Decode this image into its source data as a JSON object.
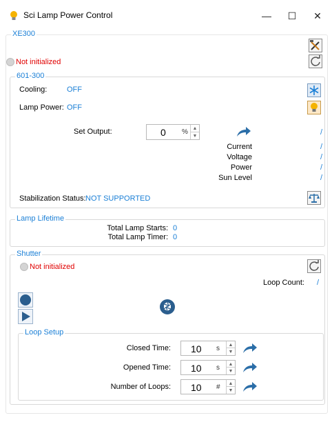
{
  "window": {
    "title": "Sci Lamp Power Control",
    "minimize_glyph": "—",
    "maximize_glyph": "☐",
    "close_glyph": "✕"
  },
  "xe300": {
    "legend": "XE300",
    "status": "Not initialized"
  },
  "psu": {
    "legend": "601-300",
    "cooling_label": "Cooling:",
    "cooling_value": "OFF",
    "lamp_power_label": "Lamp Power:",
    "lamp_power_value": "OFF",
    "set_output_label": "Set Output:",
    "set_output_value": "0",
    "set_output_unit": "%",
    "set_output_readout": "/",
    "readings": [
      {
        "label": "Current",
        "value": "/"
      },
      {
        "label": "Voltage",
        "value": "/"
      },
      {
        "label": "Power",
        "value": "/"
      },
      {
        "label": "Sun Level",
        "value": "/"
      }
    ],
    "stabilization_label": "Stabilization Status:",
    "stabilization_value": "NOT SUPPORTED"
  },
  "lifetime": {
    "legend": "Lamp Lifetime",
    "starts_label": "Total Lamp Starts:",
    "starts_value": "0",
    "timer_label": "Total Lamp Timer:",
    "timer_value": "0"
  },
  "shutter": {
    "legend": "Shutter",
    "status": "Not initialized",
    "loop_count_label": "Loop Count:",
    "loop_count_value": "/",
    "loop_setup": {
      "legend": "Loop Setup",
      "rows": [
        {
          "label": "Closed Time:",
          "value": "10",
          "unit": "s"
        },
        {
          "label": "Opened Time:",
          "value": "10",
          "unit": "s"
        },
        {
          "label": "Number of Loops:",
          "value": "10",
          "unit": "#"
        }
      ]
    }
  },
  "icons": {
    "app": "lightbulb-icon",
    "tools": "tools-icon",
    "refresh": "refresh-icon",
    "cooling": "snowflake-icon",
    "lamp": "lightbulb-icon",
    "apply": "share-arrow-icon",
    "balance": "balance-scale-icon",
    "record": "record-icon",
    "play": "play-icon",
    "shutter": "aperture-icon"
  },
  "colors": {
    "accent": "#1a7fd6",
    "error": "#e00000",
    "icon_blue": "#2b6ea8"
  }
}
